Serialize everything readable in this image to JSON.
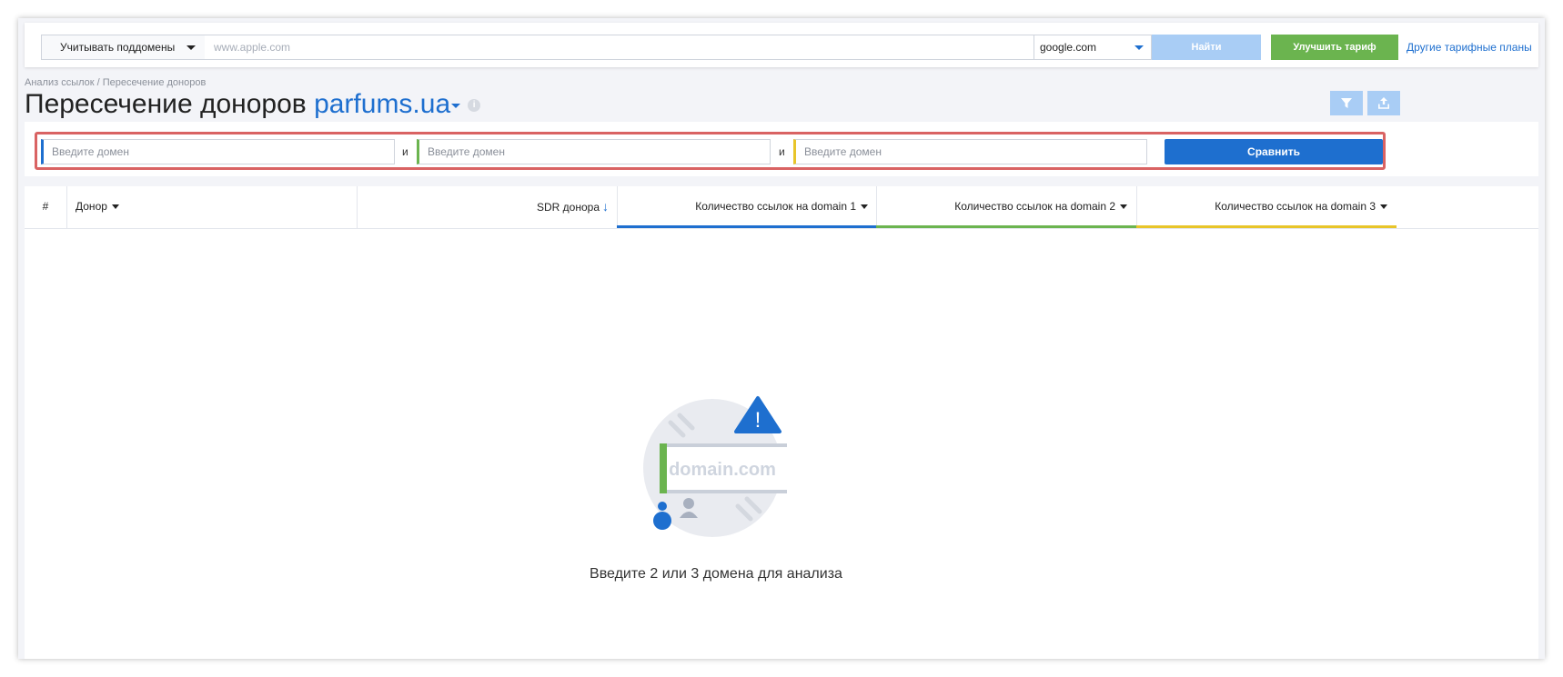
{
  "topbar": {
    "subdomain_select": "Учитывать поддомены",
    "url_placeholder": "www.apple.com",
    "search_engine": "google.com",
    "find_button": "Найти",
    "upgrade_button": "Улучшить тариф",
    "plans_link": "Другие тарифные планы"
  },
  "breadcrumb": "Анализ ссылок / Пересечение доноров",
  "page": {
    "title": "Пересечение доноров",
    "domain": "parfums.ua",
    "filter_icon": "filter-icon",
    "export_icon": "export-icon"
  },
  "compare": {
    "domain_placeholder": "Введите домен",
    "and_label": "и",
    "compare_button": "Сравнить"
  },
  "table": {
    "columns": [
      "#",
      "Донор",
      "SDR донора",
      "Количество ссылок на domain 1",
      "Количество ссылок на domain 2",
      "Количество ссылок на domain 3"
    ],
    "colors": [
      "#1e6fcf",
      "#6bb44f",
      "#e8c52a"
    ]
  },
  "empty": {
    "illustration_label": "domain.com",
    "warning_mark": "!",
    "message": "Введите 2 или 3 домена для анализа"
  }
}
